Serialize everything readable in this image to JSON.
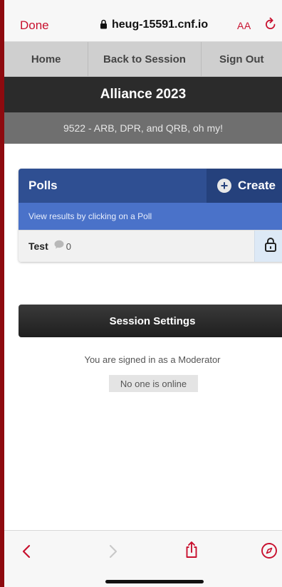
{
  "browser": {
    "done_label": "Done",
    "url": "heug-15591.cnf.io",
    "text_size_label": "AA"
  },
  "nav": {
    "items": [
      {
        "label": "Home"
      },
      {
        "label": "Back to Session"
      },
      {
        "label": "Sign Out"
      }
    ]
  },
  "event": {
    "title": "Alliance 2023"
  },
  "session": {
    "name": "9522 - ARB, DPR, and QRB, oh my!"
  },
  "polls": {
    "title": "Polls",
    "create_label": "Create",
    "hint": "View results by clicking on a Poll",
    "items": [
      {
        "name": "Test",
        "responses": "0",
        "icon": "unlock-icon"
      }
    ]
  },
  "settings": {
    "title": "Session Settings",
    "role_text": "You are signed in as a Moderator",
    "online_text": "No one is online"
  },
  "colors": {
    "accent": "#c8102e",
    "polls_header": "#2f4f92",
    "polls_subheader": "#4a72c9",
    "dark_bar": "#2b2b2b"
  }
}
